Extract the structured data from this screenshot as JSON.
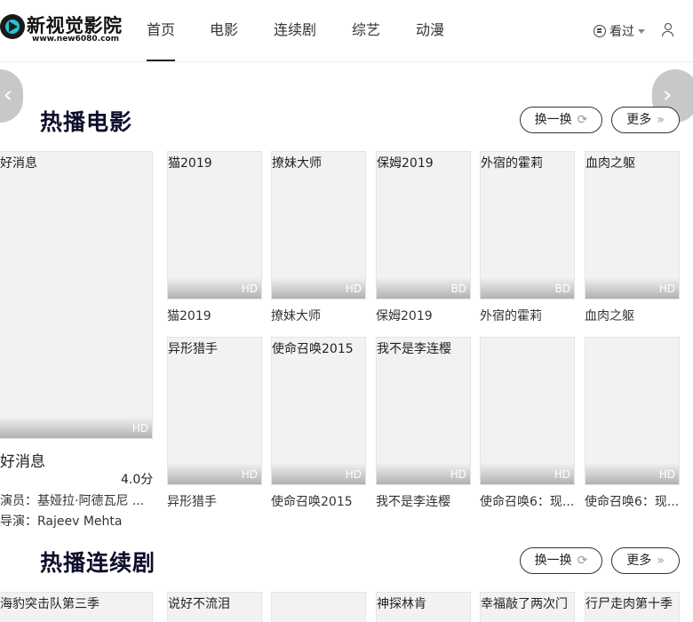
{
  "logo": {
    "name": "新视觉影院",
    "url": "www.new6080.com"
  },
  "nav": {
    "items": [
      {
        "label": "首页",
        "active": true
      },
      {
        "label": "电影",
        "active": false
      },
      {
        "label": "连续剧",
        "active": false
      },
      {
        "label": "综艺",
        "active": false
      },
      {
        "label": "动漫",
        "active": false
      }
    ]
  },
  "header": {
    "history_label": "看过"
  },
  "arrows": {
    "left": "‹",
    "right": "›"
  },
  "movies": {
    "title": "热播电影",
    "refresh_label": "换一换",
    "more_label": "更多",
    "featured": {
      "poster_title": "好消息",
      "badge": "HD",
      "title": "好消息",
      "score": "4.0分",
      "actors": "演员：基娅拉·阿德瓦尼 ...",
      "director": "导演：Rajeev  Mehta"
    },
    "items": [
      {
        "poster_title": "猫2019",
        "badge": "HD",
        "caption": "猫2019"
      },
      {
        "poster_title": "撩妹大师",
        "badge": "HD",
        "caption": "撩妹大师"
      },
      {
        "poster_title": "保姆2019",
        "badge": "BD",
        "caption": "保姆2019"
      },
      {
        "poster_title": "外宿的霍莉",
        "badge": "BD",
        "caption": "外宿的霍莉"
      },
      {
        "poster_title": "血肉之躯",
        "badge": "HD",
        "caption": "血肉之躯"
      },
      {
        "poster_title": "异形猎手",
        "badge": "HD",
        "caption": "异形猎手"
      },
      {
        "poster_title": "使命召唤2015",
        "badge": "HD",
        "caption": "使命召唤2015"
      },
      {
        "poster_title": "我不是李连樱",
        "badge": "HD",
        "caption": "我不是李连樱"
      },
      {
        "poster_title": "",
        "badge": "HD",
        "caption": "使命召唤6：现..."
      },
      {
        "poster_title": "",
        "badge": "HD",
        "caption": "使命召唤6：现..."
      }
    ]
  },
  "series": {
    "title": "热播连续剧",
    "refresh_label": "换一换",
    "more_label": "更多",
    "featured_poster_title": "海豹突击队第三季",
    "items": [
      {
        "poster_title": "说好不流泪"
      },
      {
        "poster_title": ""
      },
      {
        "poster_title": "神探林肯"
      },
      {
        "poster_title": "幸福敲了两次门"
      },
      {
        "poster_title": "行尸走肉第十季"
      }
    ]
  }
}
